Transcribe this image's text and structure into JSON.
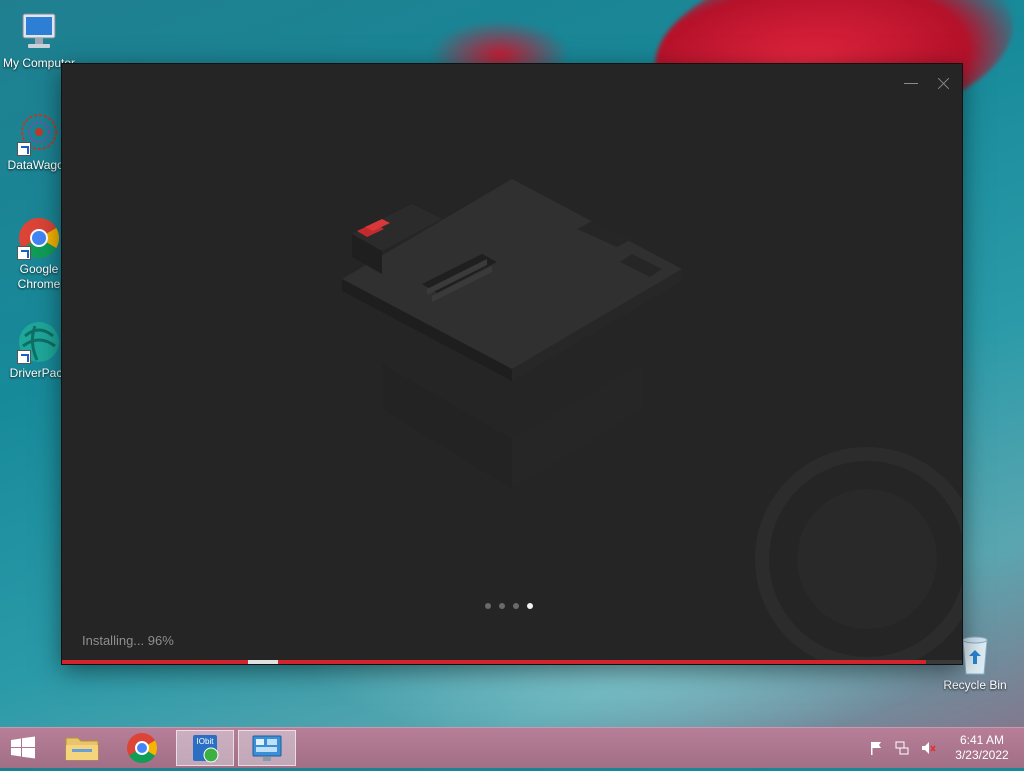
{
  "desktop": {
    "icons": [
      {
        "label": "My Computer",
        "icon": "computer-icon"
      },
      {
        "label": "DataWagon",
        "icon": "datawagon-icon"
      },
      {
        "label": "Google Chrome",
        "icon": "chrome-icon"
      },
      {
        "label": "DriverPack",
        "icon": "driverpack-icon"
      },
      {
        "label": "Recycle Bin",
        "icon": "recycle-bin-icon"
      }
    ]
  },
  "installer": {
    "status_text": "Installing... 96%",
    "progress": 0.96,
    "slides_total": 4,
    "slide_active": 4,
    "accent": "#d2242d"
  },
  "taskbar": {
    "items": [
      {
        "name": "file-explorer",
        "icon": "folder-icon",
        "active": false
      },
      {
        "name": "google-chrome",
        "icon": "chrome-icon",
        "active": false
      },
      {
        "name": "iobit-installer",
        "icon": "iobit-icon",
        "active": true
      },
      {
        "name": "control-panel",
        "icon": "control-panel-icon",
        "active": true
      }
    ],
    "clock_time": "6:41 AM",
    "clock_date": "3/23/2022"
  }
}
